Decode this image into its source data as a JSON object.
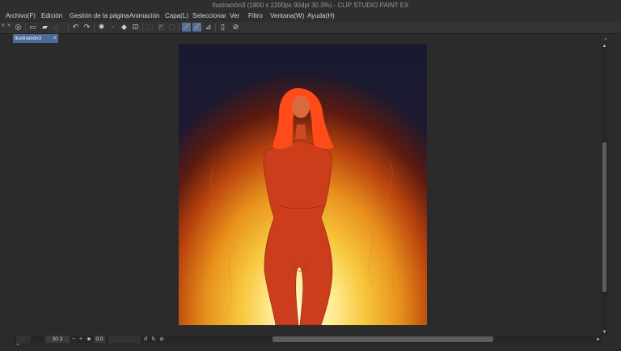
{
  "window": {
    "title": "Ilustración3 (1800 x 2200px 90dpi 30.3%) - CLIP STUDIO PAINT EX"
  },
  "menu": [
    "Archivo(F)",
    "Edición",
    "Gestión de la página",
    "Animación",
    "Capa(L)",
    "Seleccionar",
    "Ver",
    "Filtro",
    "Ventana(W)",
    "Ayuda(H)"
  ],
  "toolbar": {
    "icons": [
      "logo-icon",
      "new-file-icon",
      "open-file-icon",
      "save-icon",
      "undo-icon",
      "redo-icon",
      "loading-icon",
      "clear-icon",
      "fill-icon",
      "transform-icon",
      "deselect-icon",
      "snap-ruler-icon",
      "snap-special-ruler-icon",
      "snap-grid-icon",
      "pen-pressure-icon",
      "smartphone-icon",
      "companion-icon"
    ]
  },
  "document_tab": {
    "label": "Ilustración3",
    "close": "×"
  },
  "statusbar": {
    "zoom_value": "30.3",
    "minus": "−",
    "plus": "+",
    "rotation_value": "0.0"
  },
  "colors": {
    "accent": "#4e6a98",
    "active_tool": "#5b6f93",
    "background": "#2b2b2b"
  }
}
